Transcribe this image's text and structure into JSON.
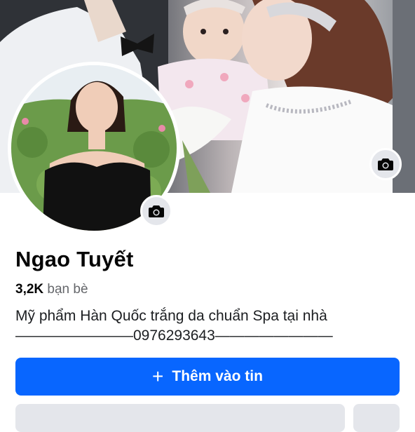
{
  "profile": {
    "name": "Ngao Tuyết",
    "friends_count": "3,2K",
    "friends_label": "bạn bè",
    "bio_line1": "Mỹ phẩm Hàn Quốc trắng da chuẩn Spa tại nhà",
    "bio_line2": "————————0976293643————————"
  },
  "actions": {
    "add_story_icon": "+",
    "add_story_label": "Thêm vào tin"
  },
  "icons": {
    "cover_camera": "camera-icon",
    "avatar_camera": "camera-icon"
  },
  "colors": {
    "primary": "#0866ff",
    "secondary_button": "#e4e6eb",
    "text_primary": "#050505",
    "text_secondary": "#65676b"
  }
}
